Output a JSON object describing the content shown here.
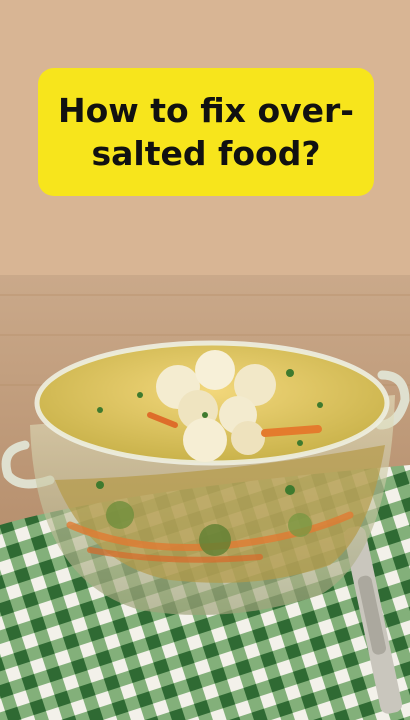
{
  "caption": {
    "text": "How to fix over-salted food?",
    "background": "#f7e51c"
  },
  "photo": {
    "subject": "glass bowl of vegetable soup with cauliflower, carrots and herbs on a green gingham cloth"
  }
}
